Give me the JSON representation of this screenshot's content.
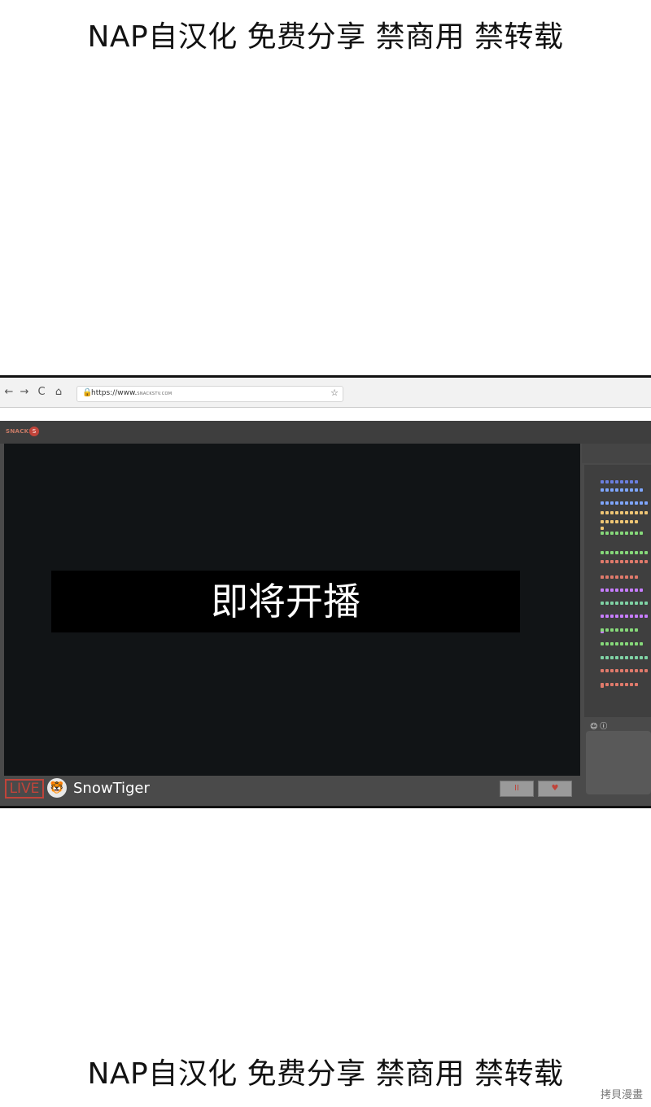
{
  "watermark_top": "NAP自汉化 免费分享 禁商用 禁转载",
  "watermark_bottom": "NAP自汉化 免费分享 禁商用 禁转载",
  "credit": "拷貝漫畫",
  "browser": {
    "back_icon": "←",
    "forward_icon": "→",
    "reload_icon": "C",
    "home_icon": "⌂",
    "lock_icon": "🔒",
    "url_prefix": "https://www.",
    "url_domain": "SNACKSTV.COM",
    "star_icon": "☆"
  },
  "app": {
    "brand": "SNACKS",
    "brand_logo": "S",
    "banner_text": "即将开播",
    "live_label": "LIVE",
    "avatar_icon": "tiger-icon",
    "streamer_name": "SnowTiger",
    "pause_label": "II",
    "heart_label": "♥",
    "chat_controls": "☺ ⓘ"
  },
  "colors": {
    "accent": "#c0443a",
    "chat_colors": [
      "#6b7fe0",
      "#7ea6ff",
      "#f0c674",
      "#86d97a",
      "#e07a6b",
      "#c77dff",
      "#7fd3a5"
    ]
  }
}
